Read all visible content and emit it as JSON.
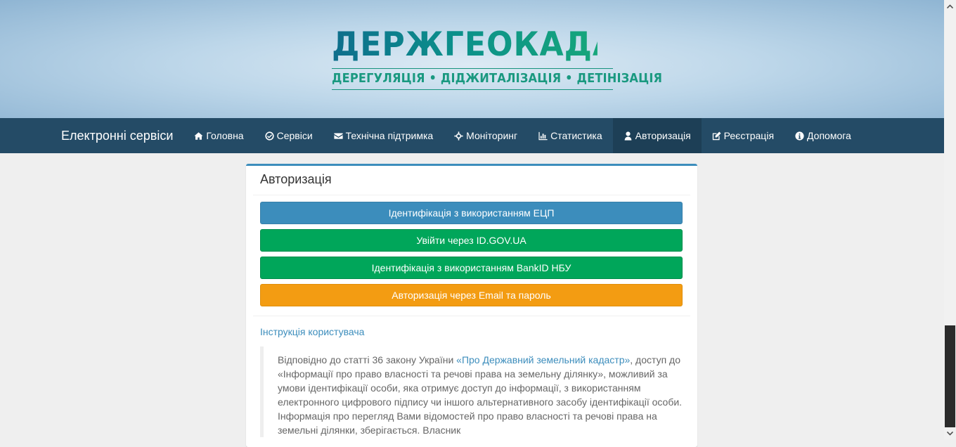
{
  "banner": {
    "logo_title": "ДЕРЖГЕОКАДАСТР",
    "logo_subtitle": "ДЕРЕГУЛЯЦІЯ • ДІДЖИТАЛІЗАЦІЯ • ДЕТІНІЗАЦІЯ"
  },
  "navbar": {
    "brand": "Електронні сервіси",
    "items": [
      {
        "label": "Головна",
        "icon": "home-icon"
      },
      {
        "label": "Сервіси",
        "icon": "check-circle-icon"
      },
      {
        "label": "Технічна підтримка",
        "icon": "envelope-icon"
      },
      {
        "label": "Моніторинг",
        "icon": "crosshairs-icon"
      },
      {
        "label": "Статистика",
        "icon": "bar-chart-icon"
      },
      {
        "label": "Авторизація",
        "icon": "user-icon",
        "active": true
      },
      {
        "label": "Реєстрація",
        "icon": "edit-icon"
      },
      {
        "label": "Допомога",
        "icon": "info-circle-icon"
      }
    ]
  },
  "panel": {
    "title": "Авторизація",
    "buttons": {
      "ecp": "Ідентифікація з використанням ЕЦП",
      "idgov": "Увійти через ID.GOV.UA",
      "bankid": "Ідентифікація з використанням BankID НБУ",
      "email": "Авторизація через Email та пароль"
    },
    "instruction_link": "Інструкція користувача",
    "notice": {
      "part1": "Відповідно до статті 36 закону України ",
      "law_link": "«Про Державний земельний кадастр»",
      "part2": ", доступ до «Інформації про право власності та речові права на земельну ділянку», можливий за умови ідентифікації особи, яка отримує доступ до інформації, з використанням електронного цифрового підпису чи іншого альтернативного засобу ідентифікації особи. Інформація про перегляд Вами відомостей про право власності та речові права на земельні ділянки, зберігається. Власник"
    }
  },
  "colors": {
    "navbar": "#244b66",
    "primary": "#3c8dbc",
    "success": "#00a65a",
    "warning": "#f39c12"
  }
}
